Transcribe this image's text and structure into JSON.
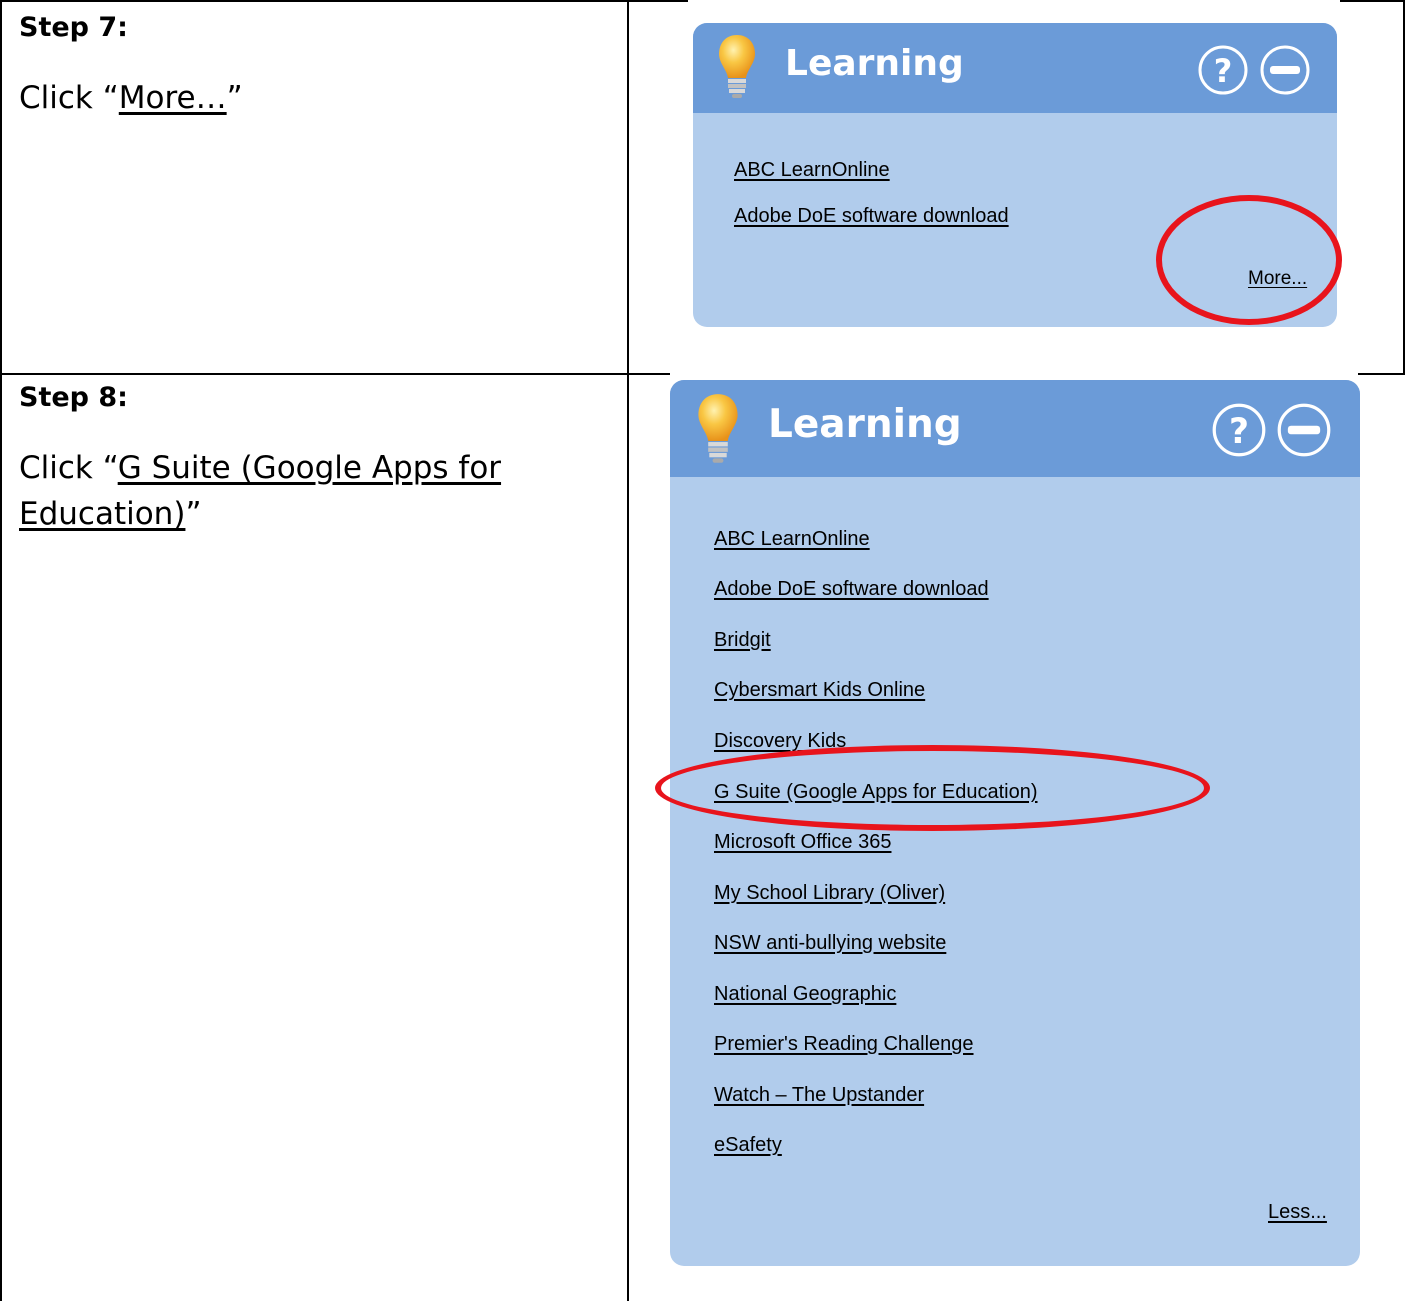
{
  "step7": {
    "title": "Step 7:",
    "instruction_prefix": "Click “",
    "instruction_link": "More…",
    "instruction_suffix": "”",
    "panel": {
      "title": "Learning",
      "links": [
        "ABC LearnOnline",
        "Adobe DoE software download"
      ],
      "more_label": "More..."
    }
  },
  "step8": {
    "title": "Step 8:",
    "instruction_prefix": "Click “",
    "instruction_link_line1": "G Suite (Google Apps for",
    "instruction_link_line2": "Education)",
    "instruction_suffix": "”",
    "panel": {
      "title": "Learning",
      "links": [
        "ABC LearnOnline",
        "Adobe DoE software download",
        "Bridgit",
        "Cybersmart Kids Online",
        "Discovery Kids",
        "G Suite (Google Apps for Education)",
        "Microsoft Office 365",
        "My School Library (Oliver)",
        "NSW anti-bullying website",
        "National Geographic",
        "Premier's Reading Challenge",
        "Watch – The Upstander",
        "eSafety"
      ],
      "less_label": "Less..."
    }
  },
  "colors": {
    "panel_body": "#b1ccec",
    "panel_header": "#6b9bd8",
    "highlight_circle": "#e8141c",
    "bulb": "#f5a623"
  },
  "icons": [
    "lightbulb-icon",
    "help-icon",
    "minimize-icon"
  ]
}
